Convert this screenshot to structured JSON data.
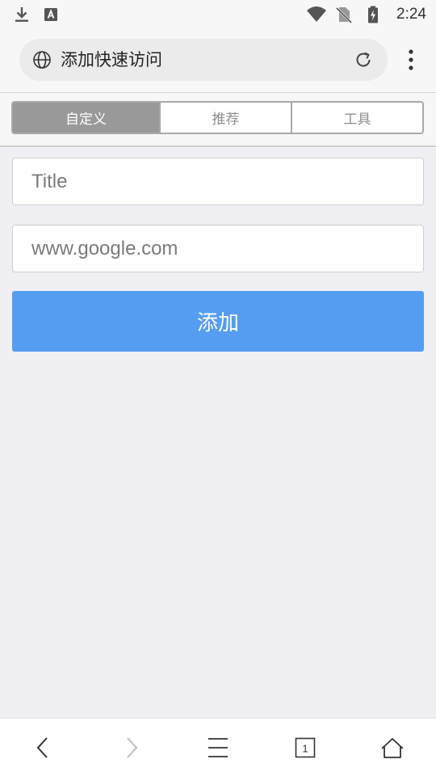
{
  "status_bar": {
    "time": "2:24",
    "left_icons": [
      "download-icon",
      "font-app-icon"
    ],
    "right_icons": [
      "wifi-icon",
      "no-sim-icon",
      "battery-charging-icon"
    ]
  },
  "toolbar": {
    "page_title": "添加快速访问",
    "left_icon": "globe-icon",
    "refresh_icon": "refresh-icon",
    "menu_icon": "more-vert-icon"
  },
  "tabs": [
    {
      "label": "自定义",
      "active": true
    },
    {
      "label": "推荐",
      "active": false
    },
    {
      "label": "工具",
      "active": false
    }
  ],
  "form": {
    "title_placeholder": "Title",
    "url_placeholder": "www.google.com",
    "title_value": "",
    "url_value": "",
    "submit_label": "添加"
  },
  "bottom_nav": {
    "items": [
      "back-icon",
      "forward-icon",
      "menu-lines-icon",
      "tabs-icon",
      "home-icon"
    ],
    "tab_count": "1"
  },
  "colors": {
    "accent": "#559df0",
    "active_tab": "#999999",
    "page_background": "#efeff4"
  }
}
